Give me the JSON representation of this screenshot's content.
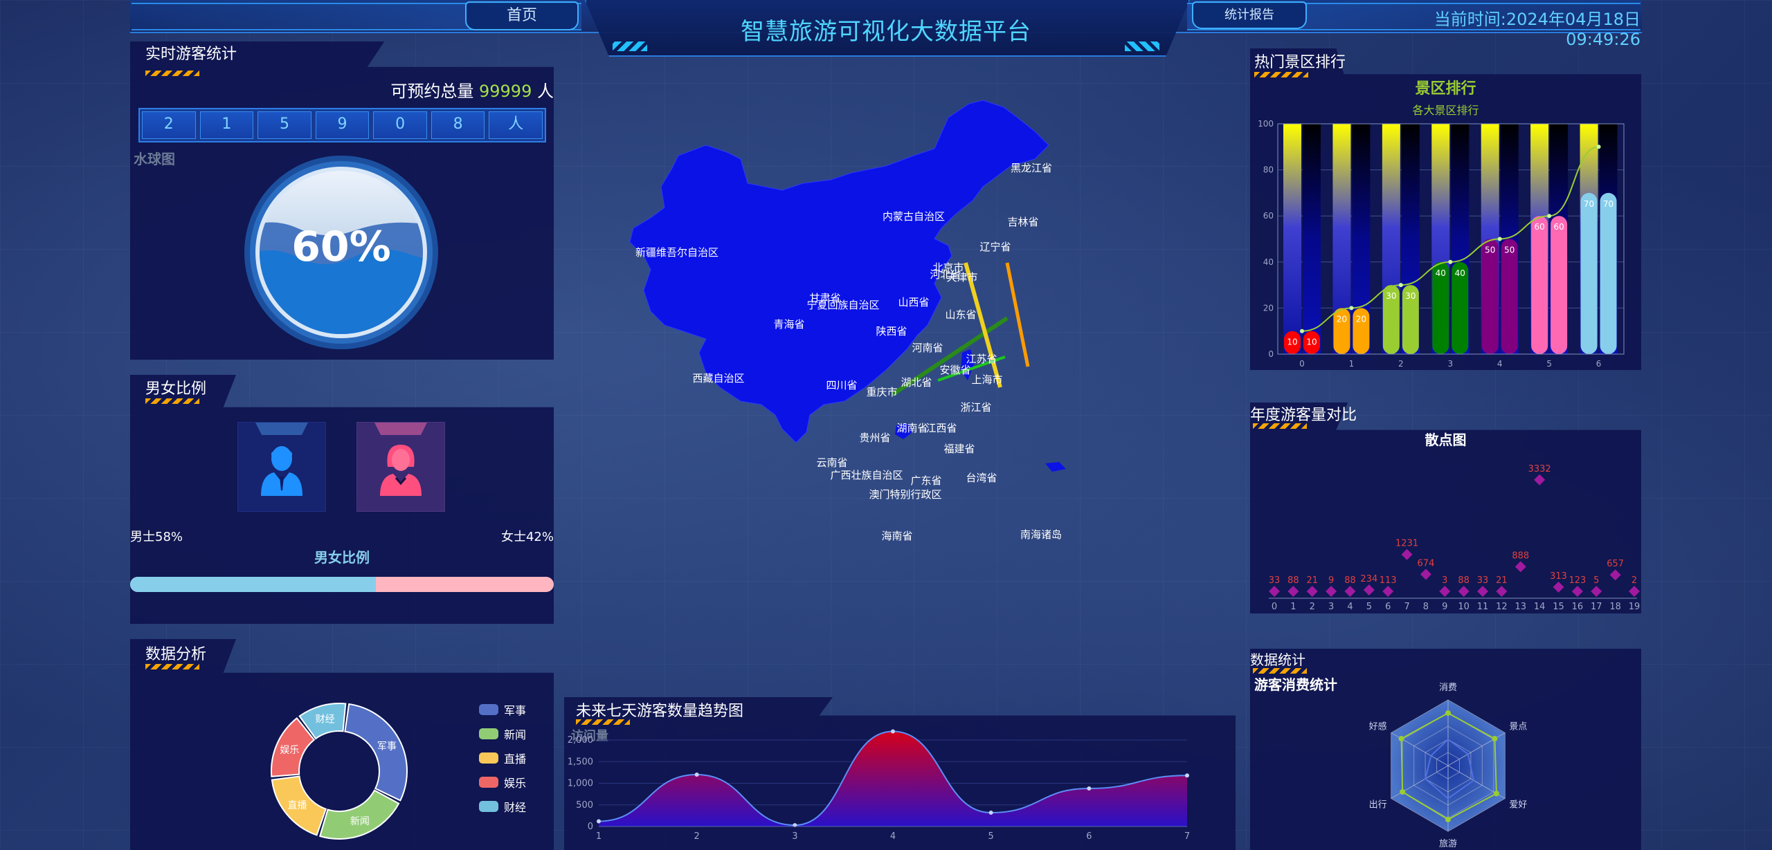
{
  "header": {
    "title": "智慧旅游可视化大数据平台",
    "nav_home": "首页",
    "nav_report": "统计报告",
    "time_label": "当前时间:",
    "time_value": "2024年04月18日 09:49:26"
  },
  "realtime": {
    "title": "实时游客统计",
    "capacity_label": "可预约总量",
    "capacity_value": "99999",
    "capacity_unit": "人",
    "digits": [
      "2",
      "1",
      "5",
      "9",
      "0",
      "8",
      "人"
    ],
    "chart_label": "水球图",
    "percent": "60%",
    "percent_value": 0.6
  },
  "gender": {
    "title": "男女比例",
    "male_text": "男士58%",
    "female_text": "女士42%",
    "bar_title": "男女比例",
    "male_ratio": 0.58,
    "colors": {
      "male": "#87ceeb",
      "female": "#ffb6c1"
    }
  },
  "analysis": {
    "title": "数据分析",
    "legend": [
      "军事",
      "新闻",
      "直播",
      "娱乐",
      "财经"
    ],
    "colors": [
      "#5470c6",
      "#91cc75",
      "#fac858",
      "#ee6666",
      "#73c0de"
    ]
  },
  "map": {
    "labels": [
      "黑龙江省",
      "内蒙古自治区",
      "吉林省",
      "辽宁省",
      "新疆维吾尔自治区",
      "北京市",
      "河北省",
      "天津市",
      "甘肃省",
      "宁夏回族自治区",
      "山西省",
      "山东省",
      "青海省",
      "陕西省",
      "河南省",
      "江苏省",
      "安徽省",
      "上海市",
      "西藏自治区",
      "四川省",
      "湖北省",
      "重庆市",
      "浙江省",
      "湖南省",
      "江西省",
      "贵州省",
      "福建省",
      "云南省",
      "广西壮族自治区",
      "广东省",
      "台湾省",
      "澳门特别行政区",
      "海南省",
      "南海诸岛"
    ]
  },
  "trend": {
    "title": "未来七天游客数量趋势图",
    "subtitle": "访问量"
  },
  "ranking": {
    "title": "热门景区排行",
    "chart_title": "景区排行",
    "chart_subtitle": "各大景区排行"
  },
  "annual": {
    "title": "年度游客量对比",
    "chart_title": "散点图"
  },
  "stats": {
    "title": "数据统计",
    "chart_title": "游客消费统计"
  },
  "chart_data": [
    {
      "id": "ranking-bar",
      "type": "bar",
      "title": "景区排行",
      "subtitle": "各大景区排行",
      "categories": [
        "0",
        "1",
        "2",
        "3",
        "4",
        "5",
        "6"
      ],
      "values": [
        10,
        20,
        30,
        40,
        50,
        60,
        70
      ],
      "line_values": [
        10,
        20,
        30,
        40,
        50,
        60,
        90
      ],
      "colors": [
        "#ff0000",
        "#ffa500",
        "#9acd32",
        "#008000",
        "#800080",
        "#ff69b4",
        "#87ceeb"
      ],
      "ylim": [
        0,
        100
      ],
      "yticks": [
        0,
        20,
        40,
        60,
        80,
        100
      ]
    },
    {
      "id": "annual-scatter",
      "type": "scatter",
      "title": "散点图",
      "x": [
        0,
        1,
        2,
        3,
        4,
        5,
        6,
        7,
        8,
        9,
        10,
        11,
        12,
        13,
        14,
        15,
        16,
        17,
        18,
        19
      ],
      "values": [
        33,
        88,
        21,
        9,
        88,
        234,
        113,
        1231,
        674,
        3,
        88,
        33,
        21,
        888,
        3332,
        313,
        123,
        5,
        657,
        2
      ],
      "ylim": [
        0,
        3600
      ]
    },
    {
      "id": "trend-area",
      "type": "area",
      "title": "未来七天游客数量趋势图",
      "x": [
        1,
        2,
        3,
        4,
        5,
        6,
        7
      ],
      "values": [
        120,
        1200,
        30,
        2200,
        320,
        880,
        1180
      ],
      "ylim": [
        0,
        2000
      ],
      "yticks": [
        0,
        500,
        1000,
        1500,
        2000
      ]
    },
    {
      "id": "analysis-donut",
      "type": "pie",
      "categories": [
        "军事",
        "新闻",
        "直播",
        "娱乐",
        "财经"
      ],
      "values": [
        30,
        22,
        18,
        16,
        12
      ]
    },
    {
      "id": "consumption-radar",
      "type": "radar",
      "title": "游客消费统计",
      "indicators": [
        "消费",
        "景点",
        "爱好",
        "旅游",
        "出行",
        "好感"
      ],
      "series": [
        {
          "values": [
            0.8,
            0.82,
            0.85,
            0.82,
            0.8,
            0.82
          ]
        },
        {
          "values": [
            0.4,
            0.35,
            0.45,
            0.5,
            0.4,
            0.3
          ]
        }
      ]
    }
  ]
}
